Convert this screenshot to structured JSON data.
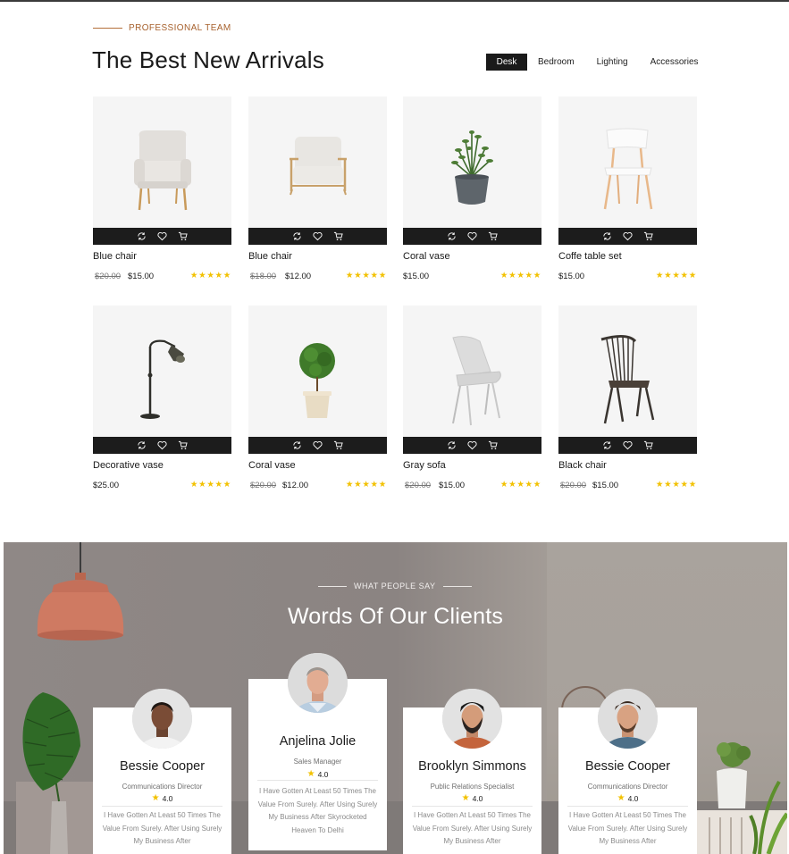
{
  "arrivals": {
    "eyebrow": "PROFESSIONAL TEAM",
    "title": "The Best New Arrivals",
    "filters": [
      "Desk",
      "Bedroom",
      "Lighting",
      "Accessories"
    ],
    "active_filter": "Desk",
    "products": [
      {
        "name": "Blue chair",
        "old_price": "$20.00",
        "price": "$15.00",
        "stars": "★★★★★",
        "image": "armchair-icon"
      },
      {
        "name": "Blue chair",
        "old_price": "$18.00",
        "price": "$12.00",
        "stars": "★★★★★",
        "image": "armchair-wood-icon"
      },
      {
        "name": "Coral vase",
        "old_price": "",
        "price": "$15.00",
        "stars": "★★★★★",
        "image": "potted-plant-icon"
      },
      {
        "name": "Coffe table set",
        "old_price": "",
        "price": "$15.00",
        "stars": "★★★★★",
        "image": "dining-chair-icon"
      },
      {
        "name": "Decorative vase",
        "old_price": "",
        "price": "$25.00",
        "stars": "★★★★★",
        "image": "floor-lamp-icon"
      },
      {
        "name": "Coral vase",
        "old_price": "$20.00",
        "price": "$12.00",
        "stars": "★★★★★",
        "image": "topiary-plant-icon"
      },
      {
        "name": "Gray sofa",
        "old_price": "$20.00",
        "price": "$15.00",
        "stars": "★★★★★",
        "image": "side-chair-icon"
      },
      {
        "name": "Black chair",
        "old_price": "$20.00",
        "price": "$15.00",
        "stars": "★★★★★",
        "image": "windsor-chair-icon"
      }
    ],
    "action_icons": [
      "refresh-icon",
      "heart-icon",
      "cart-icon"
    ]
  },
  "clients": {
    "eyebrow": "WHAT PEOPLE SAY",
    "title": "Words Of Our Clients",
    "testimonials": [
      {
        "name": "Bessie Cooper",
        "role": "Communications Director",
        "rating": "4.0",
        "quote": "I Have Gotten At Least 50 Times The Value From Surely. After Using Surely My Business After"
      },
      {
        "name": "Anjelina Jolie",
        "role": "Sales Manager",
        "rating": "4.0",
        "quote": "I Have Gotten At Least 50 Times The Value From Surely. After Using Surely My Business After Skyrocketed Heaven To Delhi"
      },
      {
        "name": "Brooklyn Simmons",
        "role": "Public Relations Specialist",
        "rating": "4.0",
        "quote": "I Have Gotten At Least 50 Times The Value From Surely. After Using Surely My Business After"
      },
      {
        "name": "Bessie Cooper",
        "role": "Communications Director",
        "rating": "4.0",
        "quote": "I Have Gotten At Least 50 Times The Value From Surely. After Using Surely My Business After"
      }
    ]
  },
  "colors": {
    "accent": "#a7612d",
    "dark": "#1c1c1c",
    "star": "#f2c100",
    "tile": "#f5f5f5"
  }
}
